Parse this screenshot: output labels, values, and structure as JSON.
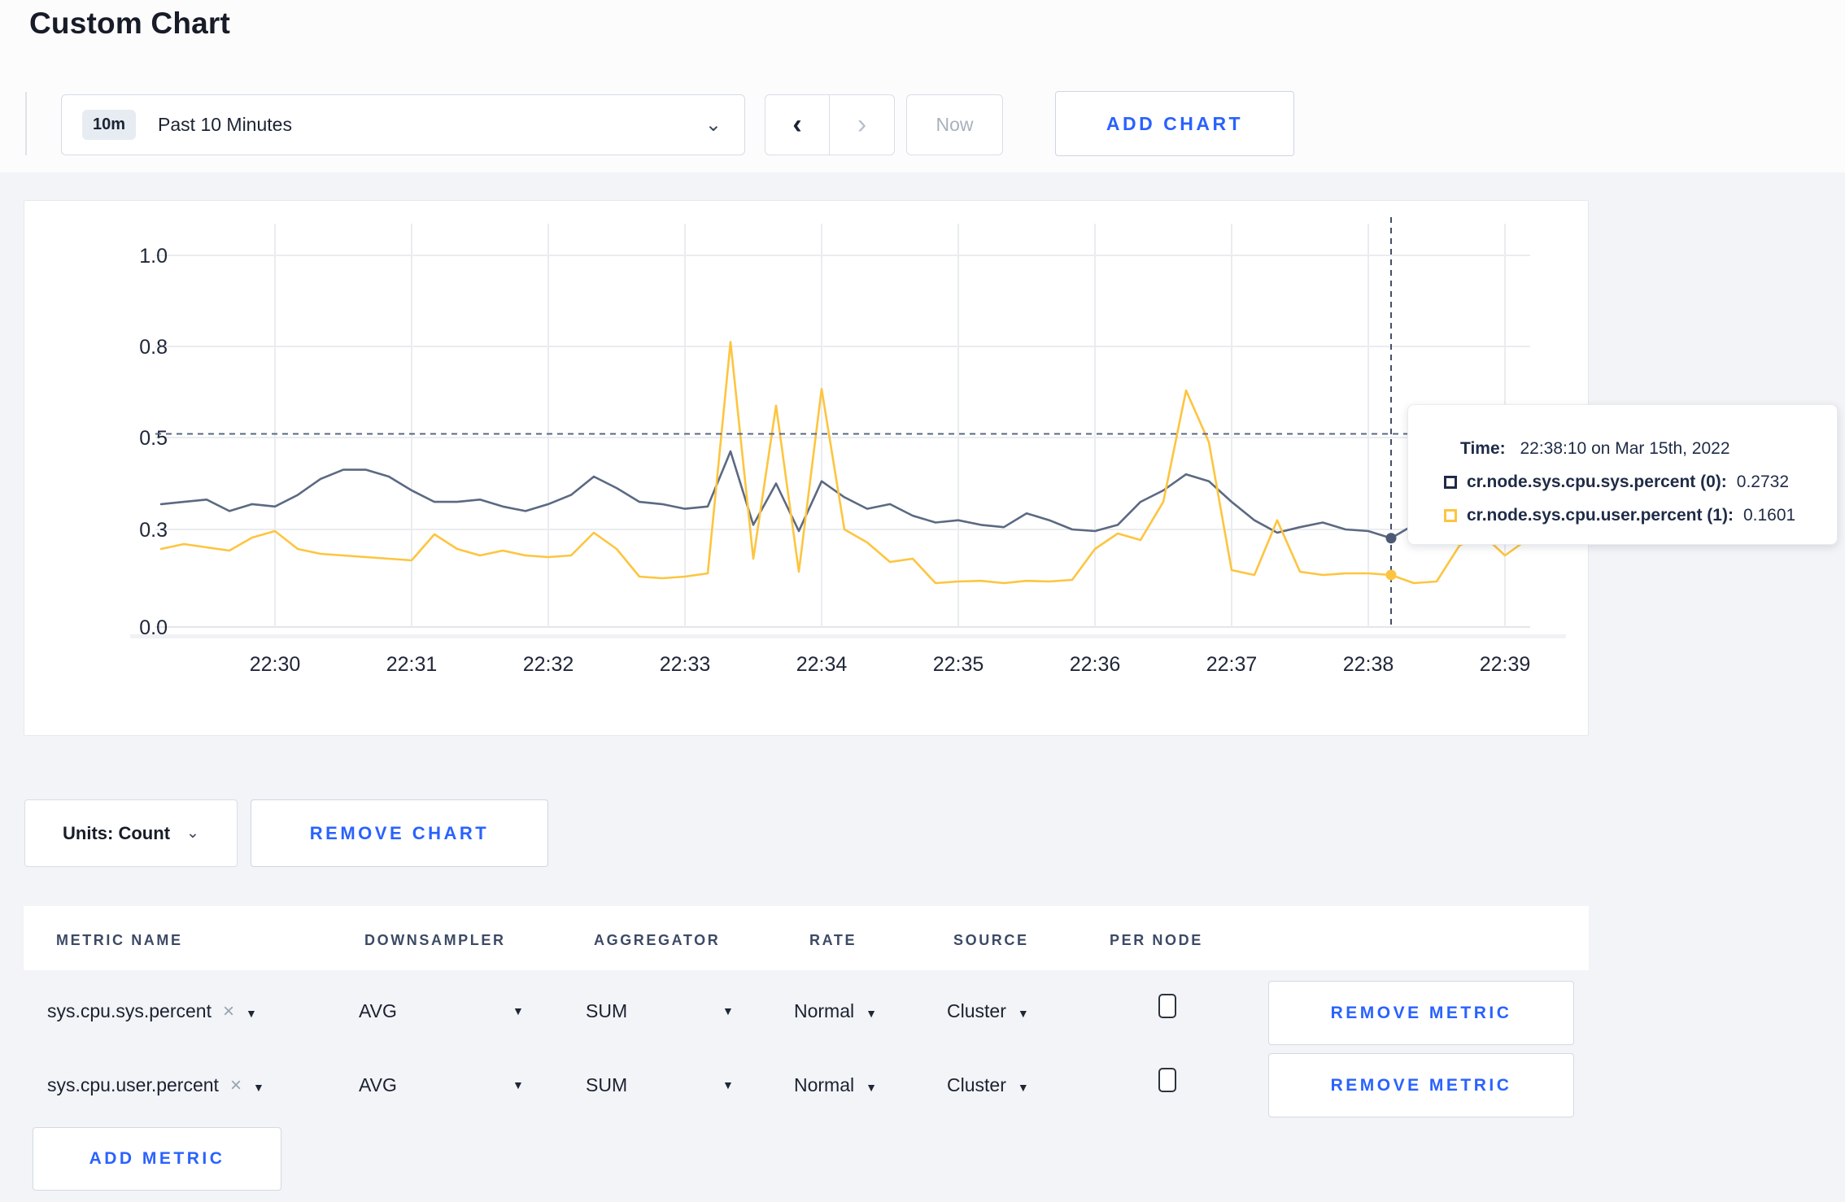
{
  "page": {
    "title": "Custom Chart"
  },
  "toolbar": {
    "range_badge": "10m",
    "range_label": "Past 10 Minutes",
    "dropdown_chevron": "⌄",
    "prev_arrow": "‹",
    "next_arrow": "›",
    "now_label": "Now",
    "add_chart_label": "ADD CHART"
  },
  "tooltip": {
    "time_label": "Time:",
    "time_value": "22:38:10 on Mar 15th, 2022",
    "series": [
      {
        "name": "cr.node.sys.cpu.sys.percent (0):",
        "value": "0.2732",
        "swatch_color": "#1f2b47"
      },
      {
        "name": "cr.node.sys.cpu.user.percent (1):",
        "value": "0.1601",
        "swatch_color": "#fdc53f"
      }
    ]
  },
  "chart_footer": {
    "units_label": "Units: Count",
    "units_chevron": "⌄",
    "remove_chart_label": "REMOVE CHART"
  },
  "metrics_table": {
    "headers": [
      "METRIC NAME",
      "DOWNSAMPLER",
      "AGGREGATOR",
      "RATE",
      "SOURCE",
      "PER NODE"
    ],
    "remove_x": "×",
    "caret": "▼",
    "rows": [
      {
        "metric": "sys.cpu.sys.percent",
        "downsampler": "AVG",
        "aggregator": "SUM",
        "rate": "Normal",
        "source": "Cluster",
        "per_node_checked": false,
        "remove_label": "REMOVE METRIC"
      },
      {
        "metric": "sys.cpu.user.percent",
        "downsampler": "AVG",
        "aggregator": "SUM",
        "rate": "Normal",
        "source": "Cluster",
        "per_node_checked": false,
        "remove_label": "REMOVE METRIC"
      }
    ],
    "add_metric_label": "ADD METRIC"
  },
  "colors": {
    "accent_blue": "#2962ff",
    "sys_line": "#5b6982",
    "user_line": "#fdc53f",
    "grid": "#eaecef",
    "axis_text": "#20273a",
    "crosshair": "#44506a"
  },
  "chart_data": {
    "type": "line",
    "title": "",
    "xlabel": "",
    "ylabel": "",
    "x_domain": [
      "22:29:10",
      "22:39:10"
    ],
    "x_start_seconds": -50,
    "x_step_seconds": 10,
    "x_tick_labels": [
      "22:30",
      "22:31",
      "22:32",
      "22:33",
      "22:34",
      "22:35",
      "22:36",
      "22:37",
      "22:38",
      "22:39"
    ],
    "y_tick_values": [
      0.0,
      0.3,
      0.5,
      0.8,
      1.0
    ],
    "y_tick_labels": [
      "0.0",
      "0.3",
      "0.5",
      "0.8",
      "1.0"
    ],
    "y_tick_spacing": "uniform",
    "grid": true,
    "legend_position": "tooltip",
    "crosshair": {
      "time": "22:38:10",
      "x_offset_seconds": 490,
      "dashed_y_value": 0.512,
      "sys_dot_value": 0.2732,
      "user_dot_value": 0.1601
    },
    "series": [
      {
        "name": "cr.node.sys.cpu.sys.percent (0)",
        "color": "#5b6982",
        "values": [
          0.355,
          0.36,
          0.365,
          0.34,
          0.355,
          0.35,
          0.375,
          0.41,
          0.43,
          0.43,
          0.415,
          0.385,
          0.36,
          0.36,
          0.365,
          0.35,
          0.34,
          0.355,
          0.375,
          0.415,
          0.39,
          0.36,
          0.355,
          0.345,
          0.35,
          0.47,
          0.31,
          0.4,
          0.295,
          0.405,
          0.37,
          0.345,
          0.355,
          0.33,
          0.315,
          0.32,
          0.31,
          0.305,
          0.335,
          0.32,
          0.3,
          0.295,
          0.31,
          0.36,
          0.385,
          0.42,
          0.405,
          0.36,
          0.32,
          0.29,
          0.305,
          0.315,
          0.3,
          0.295,
          0.2732,
          0.31,
          0.3,
          0.295,
          0.3,
          0.31,
          0.3
        ]
      },
      {
        "name": "cr.node.sys.cpu.user.percent (1)",
        "color": "#fdc53f",
        "values": [
          0.24,
          0.255,
          0.245,
          0.235,
          0.275,
          0.295,
          0.24,
          0.225,
          0.22,
          0.215,
          0.21,
          0.205,
          0.285,
          0.24,
          0.22,
          0.235,
          0.22,
          0.215,
          0.22,
          0.29,
          0.24,
          0.155,
          0.15,
          0.155,
          0.165,
          0.81,
          0.21,
          0.605,
          0.17,
          0.66,
          0.3,
          0.26,
          0.2,
          0.21,
          0.135,
          0.14,
          0.142,
          0.135,
          0.142,
          0.14,
          0.145,
          0.24,
          0.2875,
          0.2675,
          0.36,
          0.655,
          0.49,
          0.175,
          0.16,
          0.32,
          0.17,
          0.16,
          0.165,
          0.165,
          0.1601,
          0.135,
          0.14,
          0.25,
          0.285,
          0.22,
          0.27
        ]
      }
    ]
  }
}
